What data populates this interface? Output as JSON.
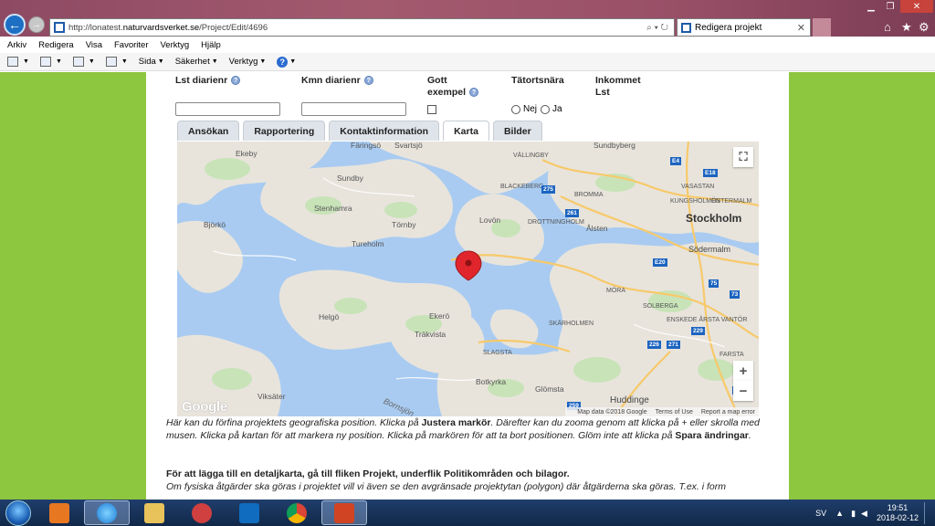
{
  "browser": {
    "url_prefix": "http://lonatest.",
    "url_domain": "naturvardsverket.se",
    "url_path": "/Project/Edit/4696",
    "tab_title": "Redigera projekt",
    "addr_controls": "⌕ ▾ ↻"
  },
  "menu": [
    "Arkiv",
    "Redigera",
    "Visa",
    "Favoriter",
    "Verktyg",
    "Hjälp"
  ],
  "commandbar": {
    "page": "Sida",
    "security": "Säkerhet",
    "tools": "Verktyg",
    "help_icon": "?"
  },
  "form": {
    "lst_label": "Lst diarienr",
    "kmn_label": "Kmn diarienr",
    "gott_label_1": "Gott",
    "gott_label_2": "exempel",
    "tatort_label": "Tätortsnära",
    "inkommet_label_1": "Inkommet",
    "inkommet_label_2": "Lst",
    "radio_no": "Nej",
    "radio_yes": "Ja",
    "lst_value": "",
    "kmn_value": ""
  },
  "tabs": [
    "Ansökan",
    "Rapportering",
    "Kontaktinformation",
    "Karta",
    "Bilder"
  ],
  "active_tab": "Karta",
  "map": {
    "place_labels": {
      "faringso": "Färingsö",
      "svartsjo": "Svartsjö",
      "ekeby": "Ekeby",
      "sundby": "Sundby",
      "stenhamra": "Stenhamra",
      "tornby": "Törnby",
      "tureholm": "Tureholm",
      "bjorko": "Björkö",
      "lovon": "Lovön",
      "helgo": "Helgö",
      "ekero": "Ekerö",
      "trakvista": "Träkvista",
      "botkyrka": "Botkyrka",
      "glomsta": "Glömsta",
      "huddinge": "Huddinge",
      "viksater": "Viksäter",
      "stockholm": "Stockholm",
      "sodermalm": "Södermalm",
      "sundbyberg": "Sundbyberg",
      "vallingby": "VÄLLINGBY",
      "blackeberg": "BLACKEBERG",
      "bromma": "BROMMA",
      "drottningholm": "DROTTNINGHOLM",
      "alsten": "Ålsten",
      "vasastan": "VASASTAN",
      "ostermalm": "ÖSTERMALM",
      "skarholmen": "SKÄRHOLMEN",
      "solberga": "SOLBERGA",
      "enskede": "ENSKEDE ÅRSTA VANTÖR",
      "farsta": "FARSTA",
      "slagsta": "SLAGSTA",
      "mora": "MÖRA",
      "kungsholmen": "KUNGSHOLMEN",
      "lake_label": "Bornsjön"
    },
    "road_shields": [
      "275",
      "261",
      "E4",
      "E18",
      "E20",
      "75",
      "73",
      "229",
      "226",
      "271",
      "259",
      "E4"
    ],
    "google_logo": "Google",
    "footer": [
      "Map data ©2018 Google",
      "Terms of Use",
      "Report a map error"
    ],
    "zoom_in": "+",
    "zoom_out": "−",
    "fullscreen_icon": "⛶"
  },
  "info": {
    "p1_a": "Här kan du förfina projektets geografiska position. Klicka på ",
    "p1_b": "Justera markör",
    "p1_c": ". Därefter kan du zooma genom att klicka på + eller skrolla med musen. Klicka på kartan för att markera ny position. Klicka på markören för att ta bort positionen. Glöm inte att klicka på ",
    "p1_d": "Spara ändringar",
    "p1_e": ".",
    "p2": "För att lägga till en detaljkarta, gå till fliken Projekt, underflik Politikområden och bilagor.",
    "p3": "Om fysiska åtgärder ska göras i projektet vill vi även se den avgränsade projektytan (polygon) där åtgärderna ska göras. T.ex. i form"
  },
  "taskbar": {
    "lang": "SV",
    "time": "19:51",
    "date": "2018-02-12"
  },
  "colors": {
    "page_bg": "#8dc63f",
    "water": "#a9cbf1",
    "land": "#e8e4dc",
    "marker": "#e0262c"
  }
}
